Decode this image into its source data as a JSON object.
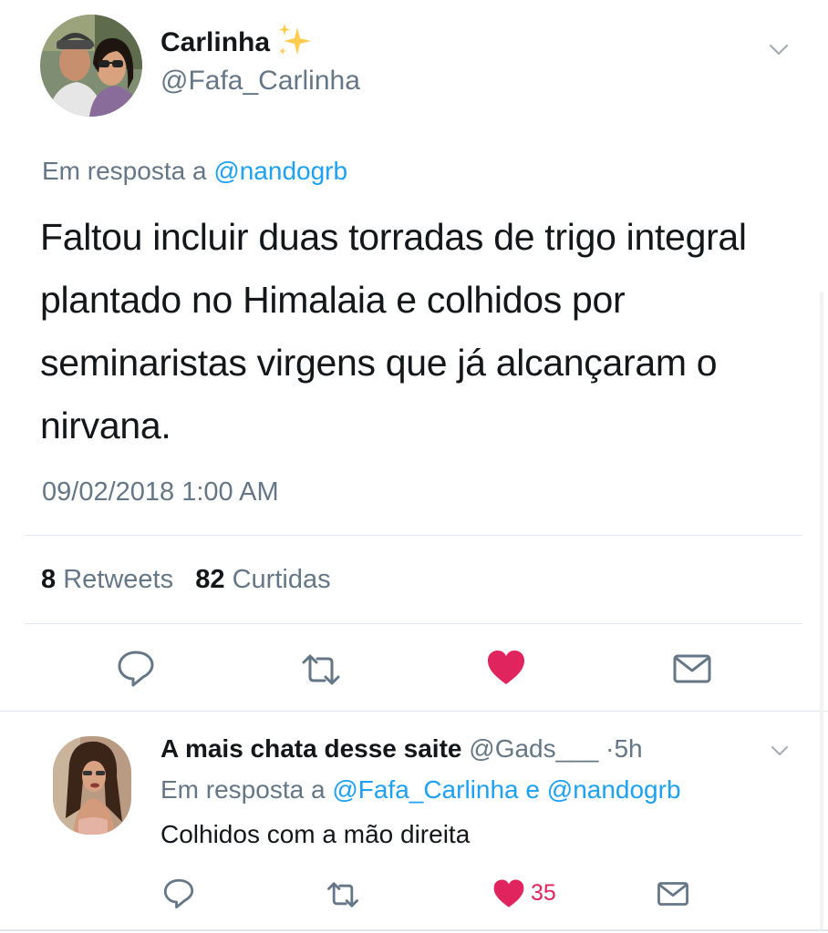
{
  "main_tweet": {
    "author_name": "Carlinha",
    "author_handle": "@Fafa_Carlinha",
    "reply_prefix": "Em resposta a",
    "reply_to": "@nandogrb",
    "text": "Faltou incluir duas torradas de trigo integral plantado no Himalaia e colhidos por seminaristas virgens que já alcançaram o nirvana.",
    "timestamp": "09/02/2018 1:00 AM",
    "retweet_count": "8",
    "retweet_label": "Retweets",
    "like_count": "82",
    "like_label": "Curtidas"
  },
  "reply_tweet": {
    "author_name": "A mais chata desse saite",
    "author_handle": "@Gads___",
    "separator": "·",
    "time_ago": "5h",
    "reply_prefix": "Em resposta a",
    "reply_to_1": "@Fafa_Carlinha",
    "reply_conjunction": "e",
    "reply_to_2": "@nandogrb",
    "text": "Colhidos com a mão direita",
    "like_count": "35"
  },
  "icons": {
    "reply": "reply-icon",
    "retweet": "retweet-icon",
    "like": "heart-icon",
    "dm": "envelope-icon",
    "menu": "chevron-down-icon",
    "emoji": "sparkles-icon"
  },
  "colors": {
    "text": "#14171a",
    "secondary": "#657786",
    "link": "#1da1f2",
    "like": "#e0245e",
    "icon": "#657786",
    "divider": "#e1e8ed"
  }
}
